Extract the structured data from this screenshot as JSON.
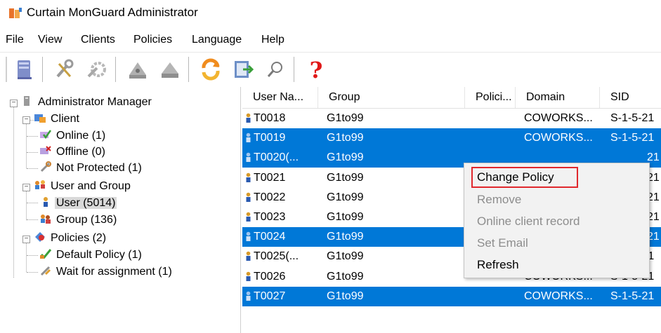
{
  "window": {
    "title": "Curtain MonGuard Administrator"
  },
  "menu": [
    "File",
    "View",
    "Clients",
    "Policies",
    "Language",
    "Help"
  ],
  "toolbar": {
    "buttons": [
      "server-icon",
      "tools-icon",
      "wrench-gear-icon",
      "upload-user-icon",
      "upload-icon",
      "refresh-icon",
      "export-icon",
      "search-icon",
      "help-icon"
    ]
  },
  "tree": {
    "root": "Administrator Manager",
    "client": "Client",
    "online": "Online (1)",
    "offline": "Offline (0)",
    "not_protected": "Not Protected (1)",
    "user_group": "User and Group",
    "user": "User (5014)",
    "group": "Group (136)",
    "policies": "Policies (2)",
    "default_policy": "Default Policy (1)",
    "wait_assign": "Wait for assignment (1)"
  },
  "table": {
    "columns": [
      "User Na...",
      "Group",
      "Polici...",
      "Domain",
      "SID"
    ],
    "rows": [
      {
        "user": "T0018",
        "group": "G1to99",
        "policy": "",
        "domain": "COWORKS...",
        "sid": "S-1-5-21",
        "selected": false
      },
      {
        "user": "T0019",
        "group": "G1to99",
        "policy": "",
        "domain": "COWORKS...",
        "sid": "S-1-5-21",
        "selected": true
      },
      {
        "user": "T0020(...",
        "group": "G1to99",
        "policy": "",
        "domain": "",
        "sid": "21",
        "selected": true
      },
      {
        "user": "T0021",
        "group": "G1to99",
        "policy": "",
        "domain": "",
        "sid": "21",
        "selected": false
      },
      {
        "user": "T0022",
        "group": "G1to99",
        "policy": "",
        "domain": "",
        "sid": "21",
        "selected": false
      },
      {
        "user": "T0023",
        "group": "G1to99",
        "policy": "",
        "domain": "",
        "sid": "21",
        "selected": false
      },
      {
        "user": "T0024",
        "group": "G1to99",
        "policy": "",
        "domain": "",
        "sid": "21",
        "selected": true
      },
      {
        "user": "T0025(...",
        "group": "G1to99",
        "policy": "",
        "domain": "COWORKS...",
        "sid": "S-1-5-21",
        "selected": false
      },
      {
        "user": "T0026",
        "group": "G1to99",
        "policy": "",
        "domain": "COWORKS...",
        "sid": "S-1-5-21",
        "selected": false
      },
      {
        "user": "T0027",
        "group": "G1to99",
        "policy": "",
        "domain": "COWORKS...",
        "sid": "S-1-5-21",
        "selected": true
      }
    ]
  },
  "context_menu": {
    "items": [
      {
        "label": "Change Policy",
        "enabled": true,
        "highlighted": true
      },
      {
        "label": "Remove",
        "enabled": false
      },
      {
        "label": "Online client record",
        "enabled": false
      },
      {
        "label": "Set Email",
        "enabled": false
      },
      {
        "label": "Refresh",
        "enabled": true
      }
    ]
  },
  "colors": {
    "selection": "#0078d7",
    "highlight_border": "#e0282d"
  }
}
